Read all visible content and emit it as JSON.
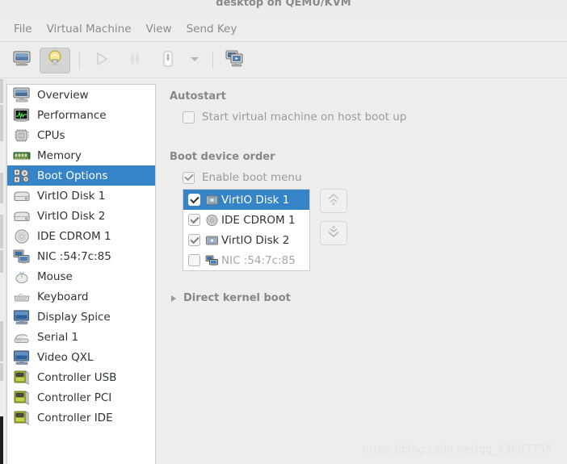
{
  "window": {
    "title": "desktop on QEMU/KVM"
  },
  "menubar": {
    "items": [
      {
        "label": "File"
      },
      {
        "label": "Virtual Machine"
      },
      {
        "label": "View"
      },
      {
        "label": "Send Key"
      }
    ]
  },
  "toolbar": {
    "buttons": [
      {
        "name": "show-console-button",
        "icon": "monitor-icon",
        "state": "normal"
      },
      {
        "name": "show-details-button",
        "icon": "lightbulb-icon",
        "state": "pressed"
      },
      {
        "name": "run-button",
        "icon": "play-icon",
        "state": "disabled"
      },
      {
        "name": "pause-button",
        "icon": "pause-icon",
        "state": "disabled"
      },
      {
        "name": "shutdown-button",
        "icon": "power-icon",
        "state": "normal"
      },
      {
        "name": "shutdown-menu-button",
        "icon": "chevron-down-icon",
        "state": "normal"
      },
      {
        "name": "snapshots-button",
        "icon": "clone-screens-icon",
        "state": "normal"
      }
    ]
  },
  "sidebar": {
    "items": [
      {
        "label": "Overview",
        "icon": "monitor-icon",
        "selected": false
      },
      {
        "label": "Performance",
        "icon": "performance-graph-icon",
        "selected": false
      },
      {
        "label": "CPUs",
        "icon": "cpu-chip-icon",
        "selected": false
      },
      {
        "label": "Memory",
        "icon": "memory-module-icon",
        "selected": false
      },
      {
        "label": "Boot Options",
        "icon": "boot-gear-icon",
        "selected": true
      },
      {
        "label": "VirtIO Disk 1",
        "icon": "harddisk-icon",
        "selected": false
      },
      {
        "label": "VirtIO Disk 2",
        "icon": "harddisk-icon",
        "selected": false
      },
      {
        "label": "IDE CDROM 1",
        "icon": "cdrom-icon",
        "selected": false
      },
      {
        "label": "NIC :54:7c:85",
        "icon": "network-icon",
        "selected": false
      },
      {
        "label": "Mouse",
        "icon": "mouse-icon",
        "selected": false
      },
      {
        "label": "Keyboard",
        "icon": "keyboard-icon",
        "selected": false
      },
      {
        "label": "Display Spice",
        "icon": "display-icon",
        "selected": false
      },
      {
        "label": "Serial 1",
        "icon": "serial-icon",
        "selected": false
      },
      {
        "label": "Video QXL",
        "icon": "display-icon",
        "selected": false
      },
      {
        "label": "Controller USB",
        "icon": "controller-card-icon",
        "selected": false
      },
      {
        "label": "Controller PCI",
        "icon": "controller-card-icon",
        "selected": false
      },
      {
        "label": "Controller IDE",
        "icon": "controller-card-icon",
        "selected": false
      }
    ]
  },
  "main": {
    "autostart": {
      "title": "Autostart",
      "checkbox_label": "Start virtual machine on host boot up",
      "checked": false,
      "enabled": false
    },
    "boot_order": {
      "title": "Boot device order",
      "enable_menu_label": "Enable boot menu",
      "enable_menu_checked": true,
      "enable_menu_enabled": false,
      "devices": [
        {
          "label": "VirtIO Disk 1",
          "icon": "harddisk-icon",
          "checked": true,
          "selected": true,
          "enabled": true
        },
        {
          "label": "IDE CDROM 1",
          "icon": "cdrom-icon",
          "checked": true,
          "selected": false,
          "enabled": true
        },
        {
          "label": "VirtIO Disk 2",
          "icon": "harddisk-icon",
          "checked": true,
          "selected": false,
          "enabled": true
        },
        {
          "label": "NIC :54:7c:85",
          "icon": "network-icon",
          "checked": false,
          "selected": false,
          "enabled": false
        }
      ],
      "move_up_icon": "double-chevron-up-icon",
      "move_down_icon": "double-chevron-down-icon"
    },
    "direct_kernel_boot": {
      "label": "Direct kernel boot",
      "expanded": false,
      "icon": "expander-triangle-icon"
    }
  },
  "watermark": {
    "text": "https://blog.csdn.net/qq_43687755"
  },
  "colors": {
    "selection_blue": "#3584c8",
    "window_bg": "#ededeb",
    "list_bg": "#ffffff",
    "muted_text": "#9b9b99"
  }
}
